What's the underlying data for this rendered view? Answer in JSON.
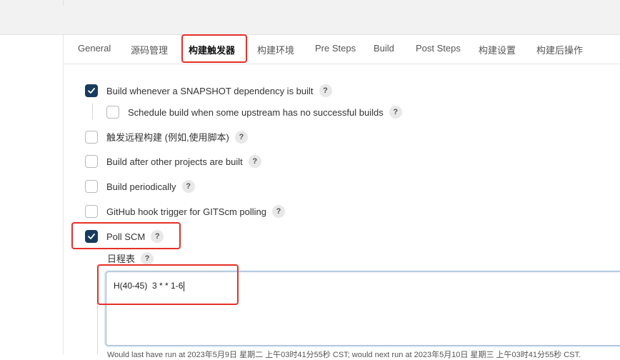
{
  "tabs": [
    {
      "label": "General"
    },
    {
      "label": "源码管理"
    },
    {
      "label": "构建触发器"
    },
    {
      "label": "构建环境"
    },
    {
      "label": "Pre Steps"
    },
    {
      "label": "Build"
    },
    {
      "label": "Post Steps"
    },
    {
      "label": "构建设置"
    },
    {
      "label": "构建后操作"
    }
  ],
  "triggers": [
    {
      "label": "Build whenever a SNAPSHOT dependency is built",
      "checked": true
    },
    {
      "label": "Schedule build when some upstream has no successful builds",
      "checked": false
    },
    {
      "label": "触发远程构建 (例如,使用脚本)",
      "checked": false
    },
    {
      "label": "Build after other projects are built",
      "checked": false
    },
    {
      "label": "Build periodically",
      "checked": false
    },
    {
      "label": "GitHub hook trigger for GITScm polling",
      "checked": false
    },
    {
      "label": "Poll SCM",
      "checked": true
    }
  ],
  "help_glyph": "?",
  "schedule": {
    "label": "日程表",
    "value": "H(40-45)  3 * * 1-6"
  },
  "footer": "Would last have run at 2023年5月9日 星期二 上午03时41分55秒 CST; would next run at 2023年5月10日 星期三 上午03时41分55秒 CST."
}
